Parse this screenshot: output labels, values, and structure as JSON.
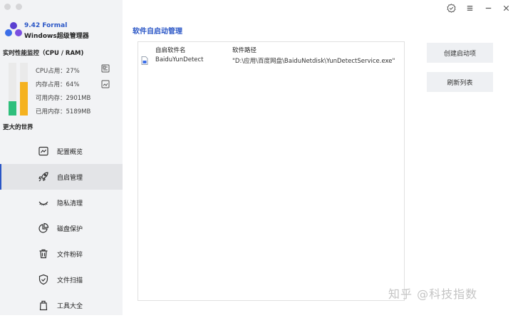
{
  "app": {
    "version": "9.42 Formal",
    "name": "Windows超级管理器"
  },
  "performance": {
    "title": "实时性能监控（CPU / RAM)",
    "cpu": "CPU占用：27%",
    "memory": "内存占用：64%",
    "available": "可用内存：2901MB",
    "used": "已用内存：5189MB",
    "cpu_percent": 27,
    "memory_percent": 64,
    "cpu_color": "#2fbf7c",
    "memory_color": "#f5b21f"
  },
  "sidebar": {
    "section_title": "更大的世界",
    "items": [
      {
        "label": "配置概览",
        "icon": "chart-icon"
      },
      {
        "label": "自启管理",
        "icon": "rocket-icon",
        "active": true
      },
      {
        "label": "隐私清理",
        "icon": "eye-closed-icon"
      },
      {
        "label": "磁盘保护",
        "icon": "pie-icon"
      },
      {
        "label": "文件粉碎",
        "icon": "trash-icon"
      },
      {
        "label": "文件扫描",
        "icon": "shield-check-icon"
      },
      {
        "label": "工具大全",
        "icon": "toolbox-icon"
      }
    ]
  },
  "main": {
    "title": "软件自启动管理",
    "columns": [
      "自启软件名",
      "软件路径"
    ],
    "rows": [
      {
        "name": "BaiduYunDetect",
        "path": "\"D:\\应用\\百度网盘\\BaiduNetdisk\\YunDetectService.exe\""
      }
    ],
    "buttons": {
      "create": "创建启动项",
      "refresh": "刷新列表"
    }
  },
  "watermark": "知乎 @科技指数",
  "accent": "#2a56c6"
}
